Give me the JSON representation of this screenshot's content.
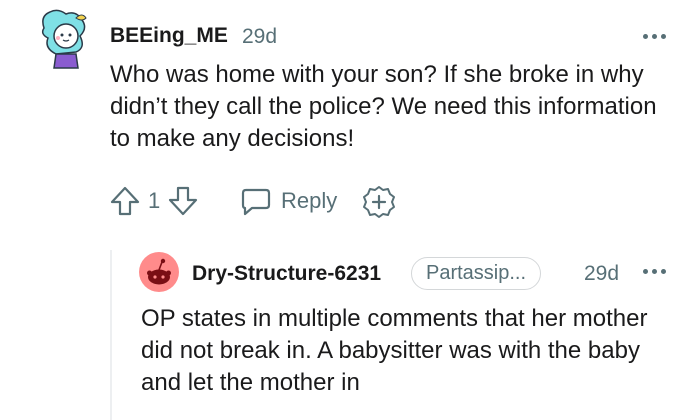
{
  "comment": {
    "username": "BEEing_ME",
    "age": "29d",
    "body": "Who was home with your son? If she broke in why didn’t they call the police? We need this information to make any decisions!",
    "score": "1",
    "reply_label": "Reply"
  },
  "reply": {
    "username": "Dry-Structure-6231",
    "flair": "Partassip...",
    "age": "29d",
    "body": "OP states in multiple comments that her mother did not break in. A babysitter was with the baby and let the mother in"
  },
  "colors": {
    "text": "#1a1a1b",
    "meta": "#576f76",
    "avatar_reply_bg": "#ff8b8b"
  },
  "icons": [
    "snoo-avatar-icon",
    "more-options-icon",
    "upvote-icon",
    "downvote-icon",
    "reply-icon",
    "award-icon",
    "default-avatar-icon"
  ]
}
